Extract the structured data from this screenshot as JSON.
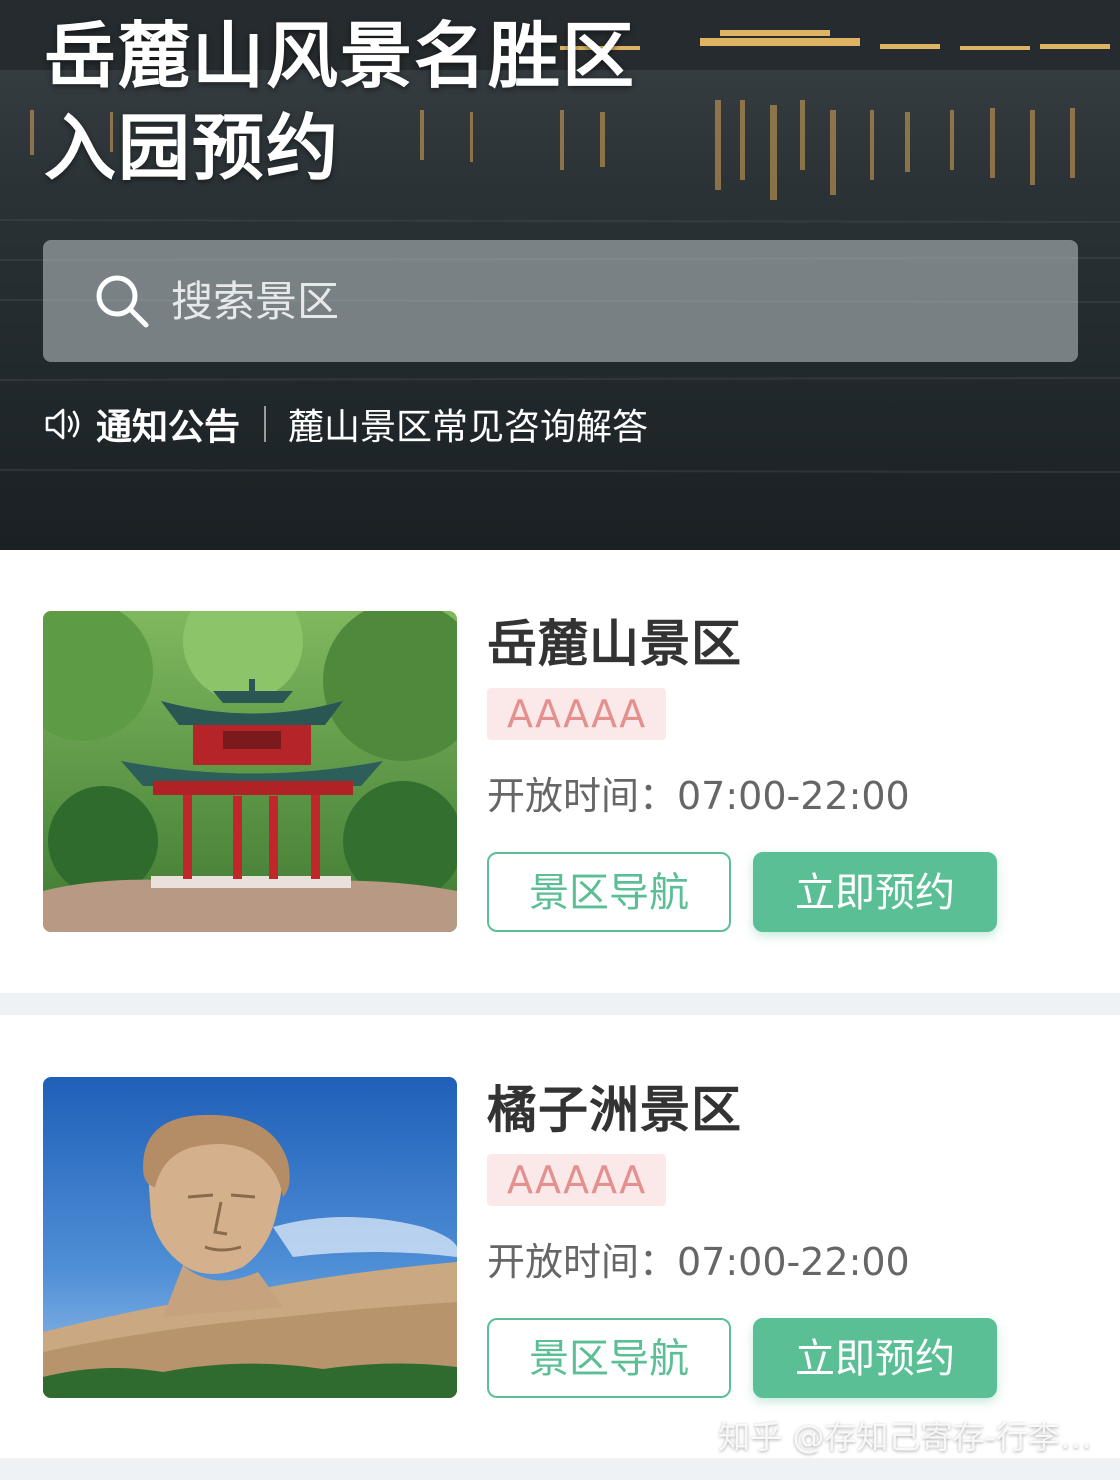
{
  "hero": {
    "title_line1": "岳麓山风景名胜区",
    "title_line2": "入园预约",
    "search_placeholder": "搜索景区",
    "notice_label": "通知公告",
    "notice_text": "麓山景区常见咨询解答"
  },
  "scenic_areas": [
    {
      "name": "岳麓山景区",
      "rating": "AAAAA",
      "hours": "开放时间：07:00-22:00",
      "nav_button": "景区导航",
      "book_button": "立即预约"
    },
    {
      "name": "橘子洲景区",
      "rating": "AAAAA",
      "hours": "开放时间：07:00-22:00",
      "nav_button": "景区导航",
      "book_button": "立即预约"
    }
  ],
  "watermark": "知乎 @存知己寄存-行李…",
  "colors": {
    "accent_green": "#5bbf95",
    "rating_text": "#e4908f",
    "rating_bg": "#fbe9e9",
    "divider_bg": "#eef2f5"
  },
  "icons": {
    "search": "search-icon",
    "notice": "speaker-icon"
  }
}
